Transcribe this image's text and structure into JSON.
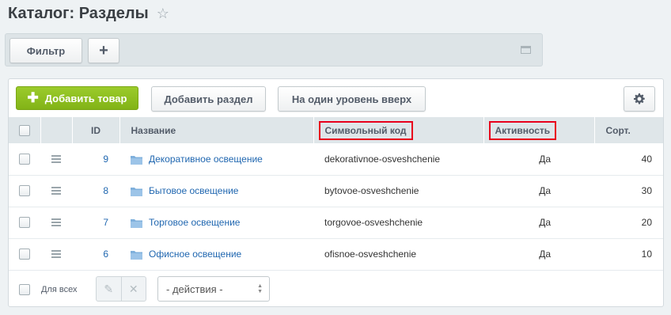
{
  "page": {
    "title": "Каталог: Разделы"
  },
  "filter_bar": {
    "filter_label": "Фильтр",
    "add_label": "+"
  },
  "toolbar": {
    "add_product_label": "Добавить товар",
    "add_section_label": "Добавить раздел",
    "level_up_label": "На один уровень вверх"
  },
  "table": {
    "columns": {
      "id": "ID",
      "name": "Название",
      "code": "Символьный код",
      "active": "Активность",
      "sort": "Сорт."
    },
    "rows": [
      {
        "id": "9",
        "name": "Декоративное освещение",
        "code": "dekorativnoe-osveshchenie",
        "active": "Да",
        "sort": "40"
      },
      {
        "id": "8",
        "name": "Бытовое освещение",
        "code": "bytovoe-osveshchenie",
        "active": "Да",
        "sort": "30"
      },
      {
        "id": "7",
        "name": "Торговое освещение",
        "code": "torgovoe-osveshchenie",
        "active": "Да",
        "sort": "20"
      },
      {
        "id": "6",
        "name": "Офисное освещение",
        "code": "ofisnoe-osveshchenie",
        "active": "Да",
        "sort": "10"
      }
    ]
  },
  "footer": {
    "for_all_label": "Для всех",
    "actions_select": "- действия -"
  },
  "colors": {
    "accent_green": "#8bbf1f",
    "link_blue": "#2067b0",
    "highlight_red": "#e8001c"
  }
}
